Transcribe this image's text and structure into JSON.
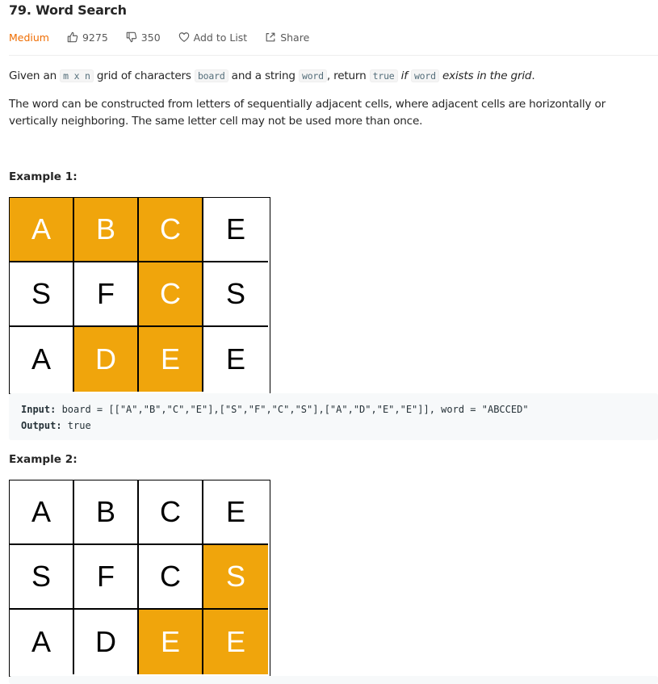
{
  "problem": {
    "title": "79. Word Search",
    "difficulty": "Medium",
    "likes": "9275",
    "dislikes": "350",
    "add_to_list": "Add to List",
    "share": "Share"
  },
  "description": {
    "p1": {
      "t1": "Given an ",
      "c1": "m x n",
      "t2": " grid of characters ",
      "c2": "board",
      "t3": " and a string ",
      "c3": "word",
      "t4": ", return ",
      "c4": "true",
      "t5": " if ",
      "c5": "word",
      "t6": " exists in the grid",
      "t7": "."
    },
    "p2": "The word can be constructed from letters of sequentially adjacent cells, where adjacent cells are horizontally or vertically neighboring. The same letter cell may not be used more than once."
  },
  "example1": {
    "title": "Example 1:",
    "grid": [
      [
        "A",
        "B",
        "C",
        "E"
      ],
      [
        "S",
        "F",
        "C",
        "S"
      ],
      [
        "A",
        "D",
        "E",
        "E"
      ]
    ],
    "highlight": [
      [
        true,
        true,
        true,
        false
      ],
      [
        false,
        false,
        true,
        false
      ],
      [
        false,
        true,
        true,
        false
      ]
    ],
    "input_label": "Input:",
    "input_value": " board = [[\"A\",\"B\",\"C\",\"E\"],[\"S\",\"F\",\"C\",\"S\"],[\"A\",\"D\",\"E\",\"E\"]], word = \"ABCCED\"",
    "output_label": "Output:",
    "output_value": " true"
  },
  "example2": {
    "title": "Example 2:",
    "grid": [
      [
        "A",
        "B",
        "C",
        "E"
      ],
      [
        "S",
        "F",
        "C",
        "S"
      ],
      [
        "A",
        "D",
        "E",
        "E"
      ]
    ],
    "highlight": [
      [
        false,
        false,
        false,
        false
      ],
      [
        false,
        false,
        false,
        true
      ],
      [
        false,
        false,
        true,
        true
      ]
    ]
  },
  "colors": {
    "highlight": "#f0a50c",
    "difficulty": "#ef6c00"
  }
}
